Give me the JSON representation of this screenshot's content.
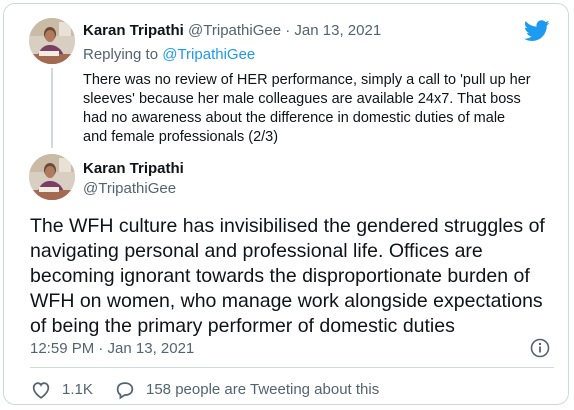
{
  "parent_tweet": {
    "author_name": "Karan Tripathi",
    "author_handle": "@TripathiGee",
    "separator": "·",
    "date": "Jan 13, 2021",
    "replying_prefix": "Replying to",
    "replying_to": "@TripathiGee",
    "text": "There was no review of HER performance, simply a call to 'pull up her sleeves' because her male colleagues are available 24x7. That boss had no awareness about the difference in domestic duties of male and female professionals (2/3)"
  },
  "main_tweet": {
    "author_name": "Karan Tripathi",
    "author_handle": "@TripathiGee",
    "text": "The WFH culture has invisibilised the gendered struggles of navigating personal and professional life. Offices are becoming ignorant towards the disproportionate burden of WFH on women, who manage work alongside expectations of being the primary performer of domestic duties",
    "timestamp": "12:59 PM · Jan 13, 2021",
    "likes": "1.1K",
    "tweeting_text": "158 people are Tweeting about this"
  },
  "icons": {
    "brand": "twitter-bird-icon",
    "info": "info-icon",
    "like": "heart-icon",
    "reply": "speech-bubble-icon"
  },
  "colors": {
    "brand_blue": "#1d9bf0",
    "text_primary": "#0f1419",
    "text_secondary": "#536471",
    "border": "#cfd9de"
  }
}
